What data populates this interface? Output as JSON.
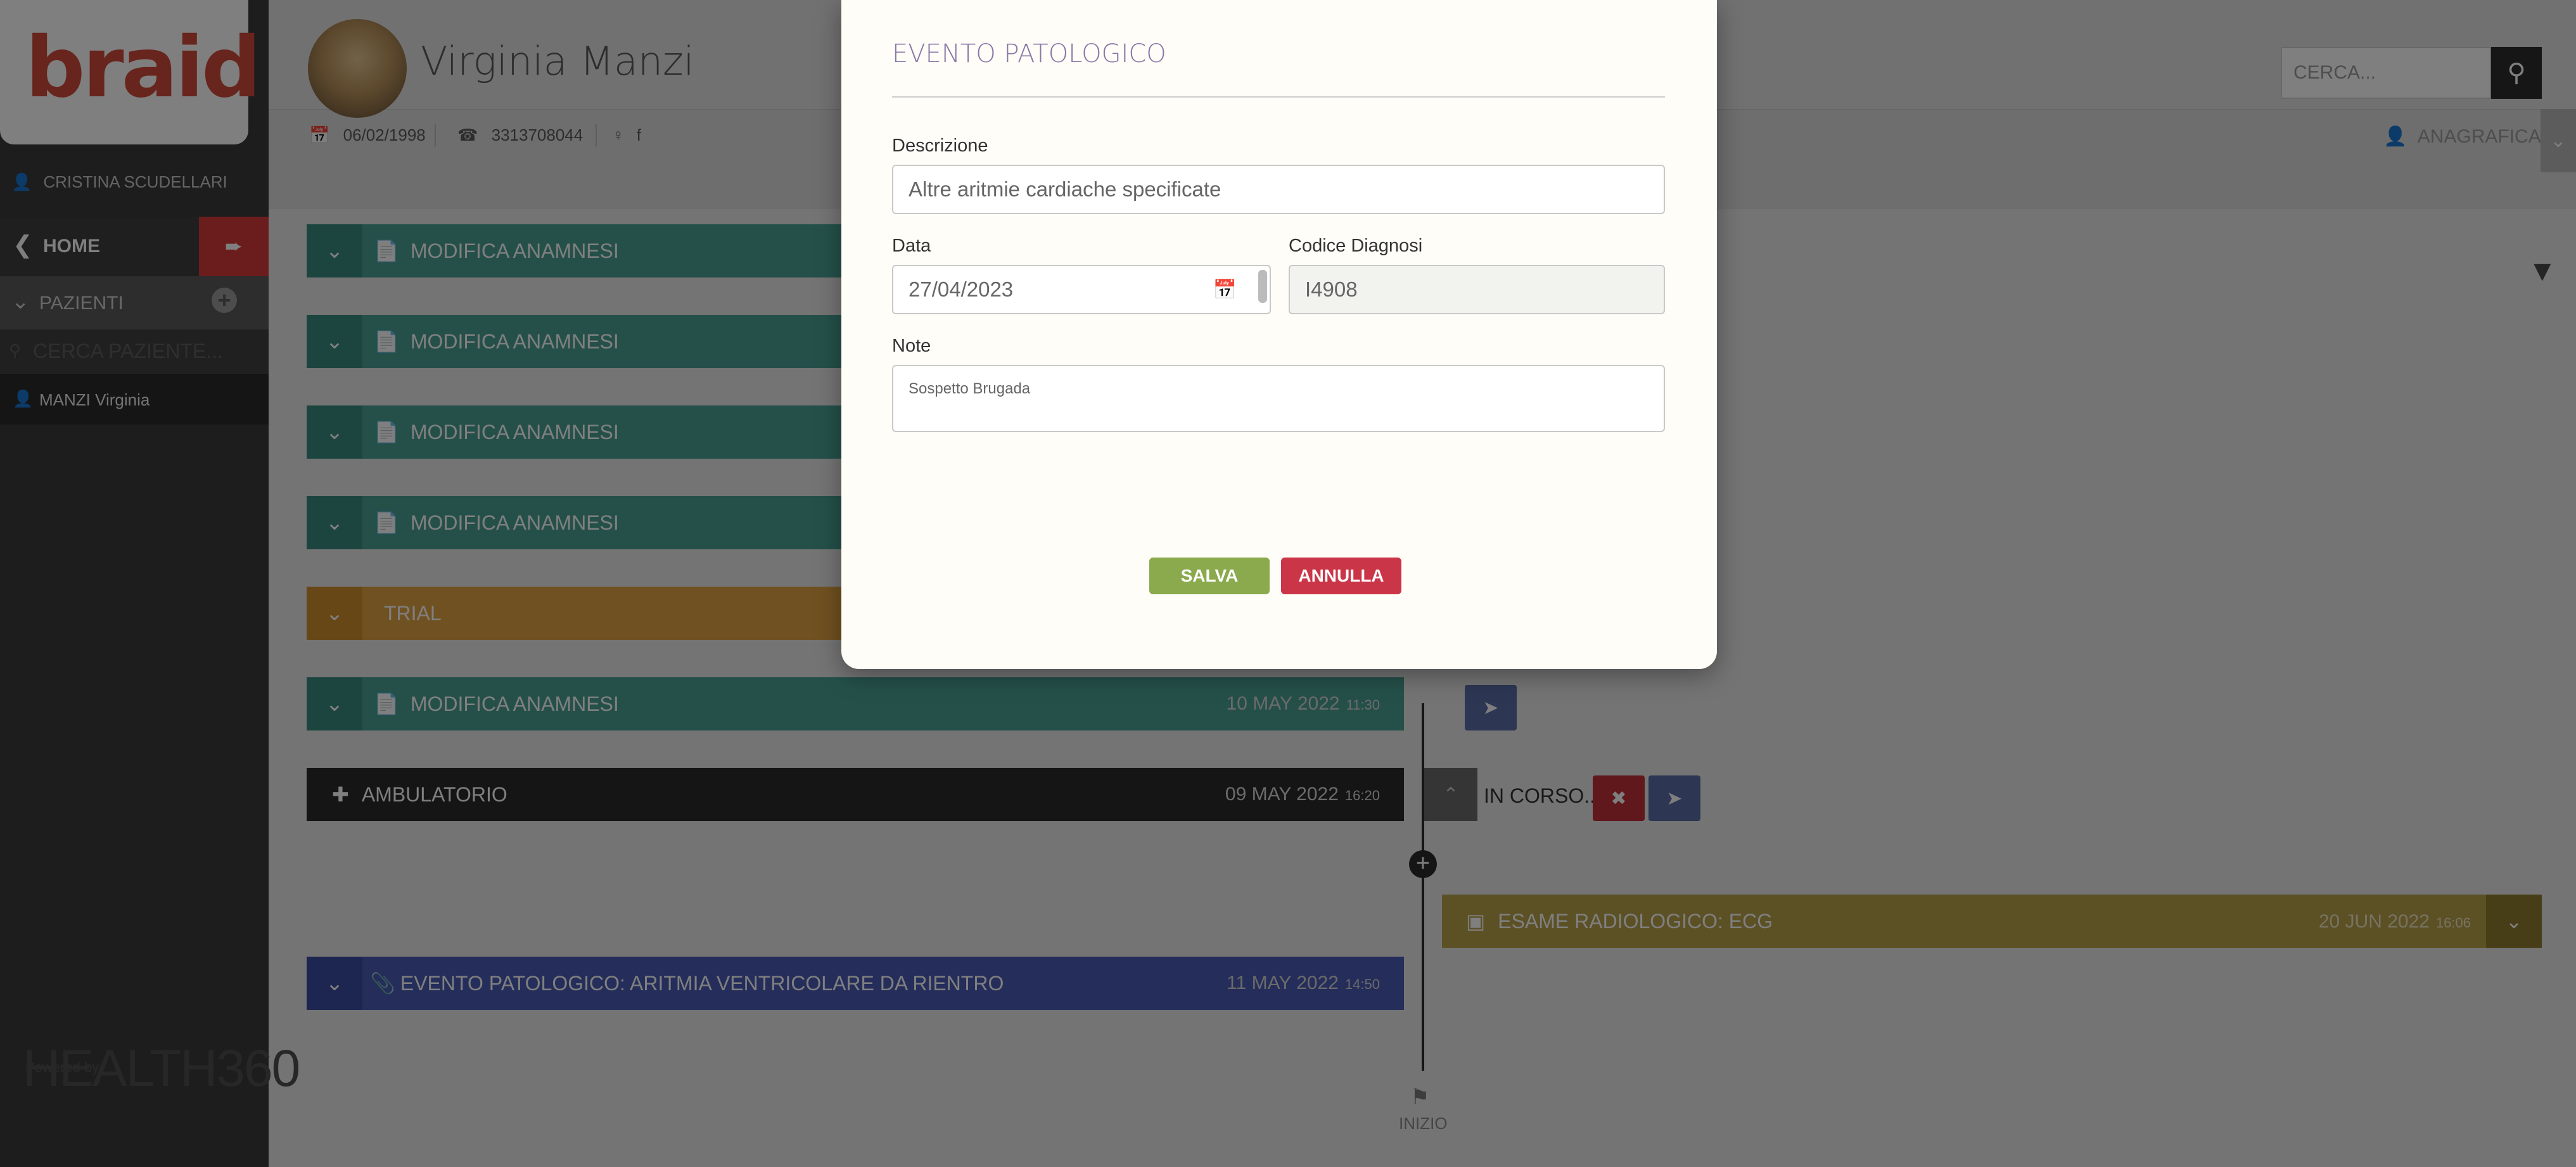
{
  "sidebar": {
    "logo_text": "braid",
    "user_name": "CRISTINA SCUDELLARI",
    "home_label": "HOME",
    "pazienti_label": "PAZIENTI",
    "search_placeholder": "CERCA PAZIENTE...",
    "patient_entry": "MANZI Virginia",
    "powered_small": "Powered by",
    "powered_brand": "HEALTH360"
  },
  "header": {
    "patient_name": "Virginia Manzi",
    "birth_date": "06/02/1998",
    "phone": "3313708044",
    "sex": "f",
    "search_placeholder": "CERCA...",
    "anagrafica_label": "ANAGRAFICA"
  },
  "timeline": {
    "items": [
      {
        "label": "MODIFICA ANAMNESI"
      },
      {
        "label": "MODIFICA ANAMNESI"
      },
      {
        "label": "MODIFICA ANAMNESI"
      },
      {
        "label": "MODIFICA ANAMNESI"
      },
      {
        "label": "TRIAL"
      },
      {
        "label": "MODIFICA ANAMNESI",
        "date": "10 MAY 2022",
        "time": "11:30"
      },
      {
        "label": "AMBULATORIO",
        "date": "09 MAY 2022",
        "time": "16:20"
      },
      {
        "label": "EVENTO PATOLOGICO: ARITMIA VENTRICOLARE DA RIENTRO",
        "date": "11 MAY 2022",
        "time": "14:50"
      }
    ],
    "in_corso": "IN CORSO...",
    "esame": {
      "label": "ESAME RADIOLOGICO: ECG",
      "date": "20 JUN 2022",
      "time": "16:06"
    },
    "start_label": "INIZIO"
  },
  "modal": {
    "title": "EVENTO PATOLOGICO",
    "descrizione_label": "Descrizione",
    "descrizione_placeholder": "Altre aritmie cardiache specificate",
    "data_label": "Data",
    "data_value": "27/04/2023",
    "codice_label": "Codice Diagnosi",
    "codice_value": "I4908",
    "note_label": "Note",
    "note_value": "Sospetto Brugada",
    "save_label": "SALVA",
    "cancel_label": "ANNULLA"
  },
  "colors": {
    "teal": "#4aa194",
    "gold": "#e0a243",
    "navy": "#4a5bb6",
    "save": "#8aaa4d",
    "cancel": "#cb3548",
    "esame": "#b8a04a"
  },
  "icons": [
    "user-icon",
    "chevron-left-icon",
    "logout-icon",
    "chevron-down-icon",
    "plus-circle-icon",
    "search-icon",
    "calendar-icon",
    "phone-icon",
    "female-icon",
    "document-icon",
    "filter-icon",
    "share-icon",
    "close-icon",
    "image-icon",
    "flag-icon",
    "paperclip-icon",
    "medical-kit-icon"
  ]
}
